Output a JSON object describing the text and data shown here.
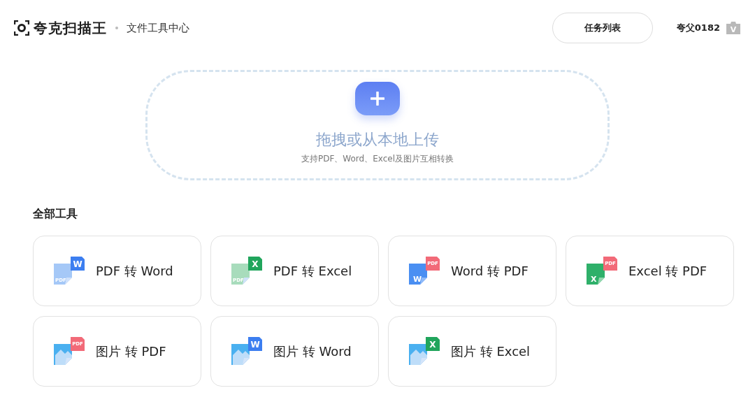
{
  "header": {
    "brand": "夸克扫描王",
    "section": "文件工具中心",
    "task_button": "任务列表",
    "user": "夸父0182",
    "vip_mark": "V"
  },
  "upload": {
    "title": "拖拽或从本地上传",
    "subtitle": "支持PDF、Word、Excel及图片互相转换"
  },
  "tools_title": "全部工具",
  "tools": [
    {
      "label": "PDF 转 Word",
      "source": {
        "kind": "pdf",
        "mark": "PDF"
      },
      "target": {
        "kind": "word",
        "mark": "W"
      }
    },
    {
      "label": "PDF 转 Excel",
      "source": {
        "kind": "pdf",
        "mark": "PDF"
      },
      "target": {
        "kind": "excel",
        "mark": "X"
      }
    },
    {
      "label": "Word 转 PDF",
      "source": {
        "kind": "word",
        "mark": "W"
      },
      "target": {
        "kind": "pdf",
        "mark": "PDF"
      }
    },
    {
      "label": "Excel 转 PDF",
      "source": {
        "kind": "excel",
        "mark": "X"
      },
      "target": {
        "kind": "pdf",
        "mark": "PDF"
      }
    },
    {
      "label": "图片 转 PDF",
      "source": {
        "kind": "image"
      },
      "target": {
        "kind": "pdf",
        "mark": "PDF"
      }
    },
    {
      "label": "图片 转 Word",
      "source": {
        "kind": "image"
      },
      "target": {
        "kind": "word",
        "mark": "W"
      }
    },
    {
      "label": "图片 转 Excel",
      "source": {
        "kind": "image"
      },
      "target": {
        "kind": "excel",
        "mark": "X"
      }
    }
  ]
}
